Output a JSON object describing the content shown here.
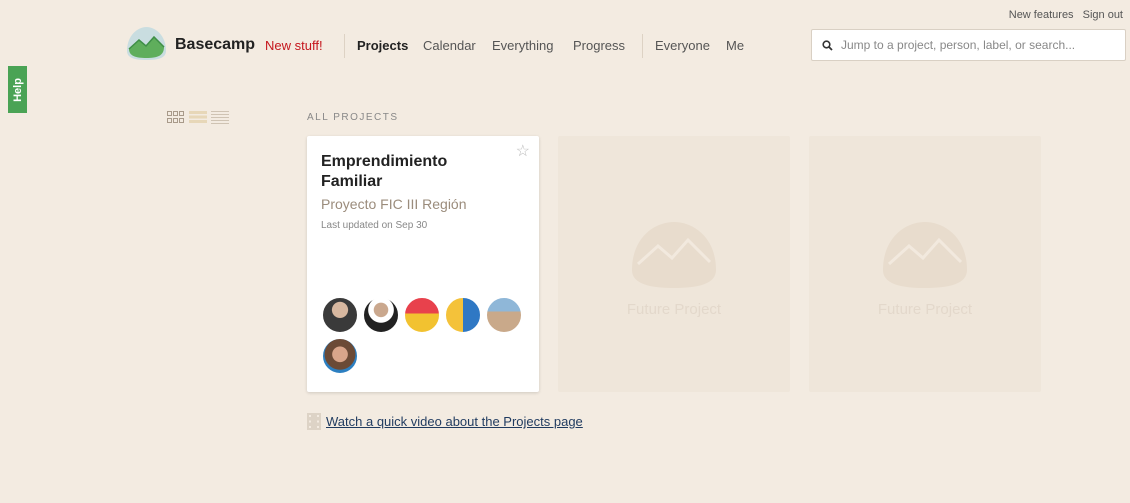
{
  "top_links": [
    "New features",
    "Sign out"
  ],
  "help_label": "Help",
  "brand": "Basecamp",
  "new_stuff": "New stuff!",
  "nav": {
    "projects": "Projects",
    "calendar": "Calendar",
    "everything": "Everything",
    "progress": "Progress",
    "everyone": "Everyone",
    "me": "Me"
  },
  "search": {
    "placeholder": "Jump to a project, person, label, or search..."
  },
  "section_title": "ALL PROJECTS",
  "project": {
    "title": "Emprendimiento Familiar",
    "subtitle": "Proyecto FIC III Región",
    "updated": "Last updated on Sep 30",
    "member_count": 6
  },
  "future_project_label": "Future Project",
  "video_link": "Watch a quick video about the Projects page",
  "colors": {
    "accent_green": "#4aa355",
    "new_stuff_red": "#c5161d",
    "background": "#f3ebe1"
  }
}
